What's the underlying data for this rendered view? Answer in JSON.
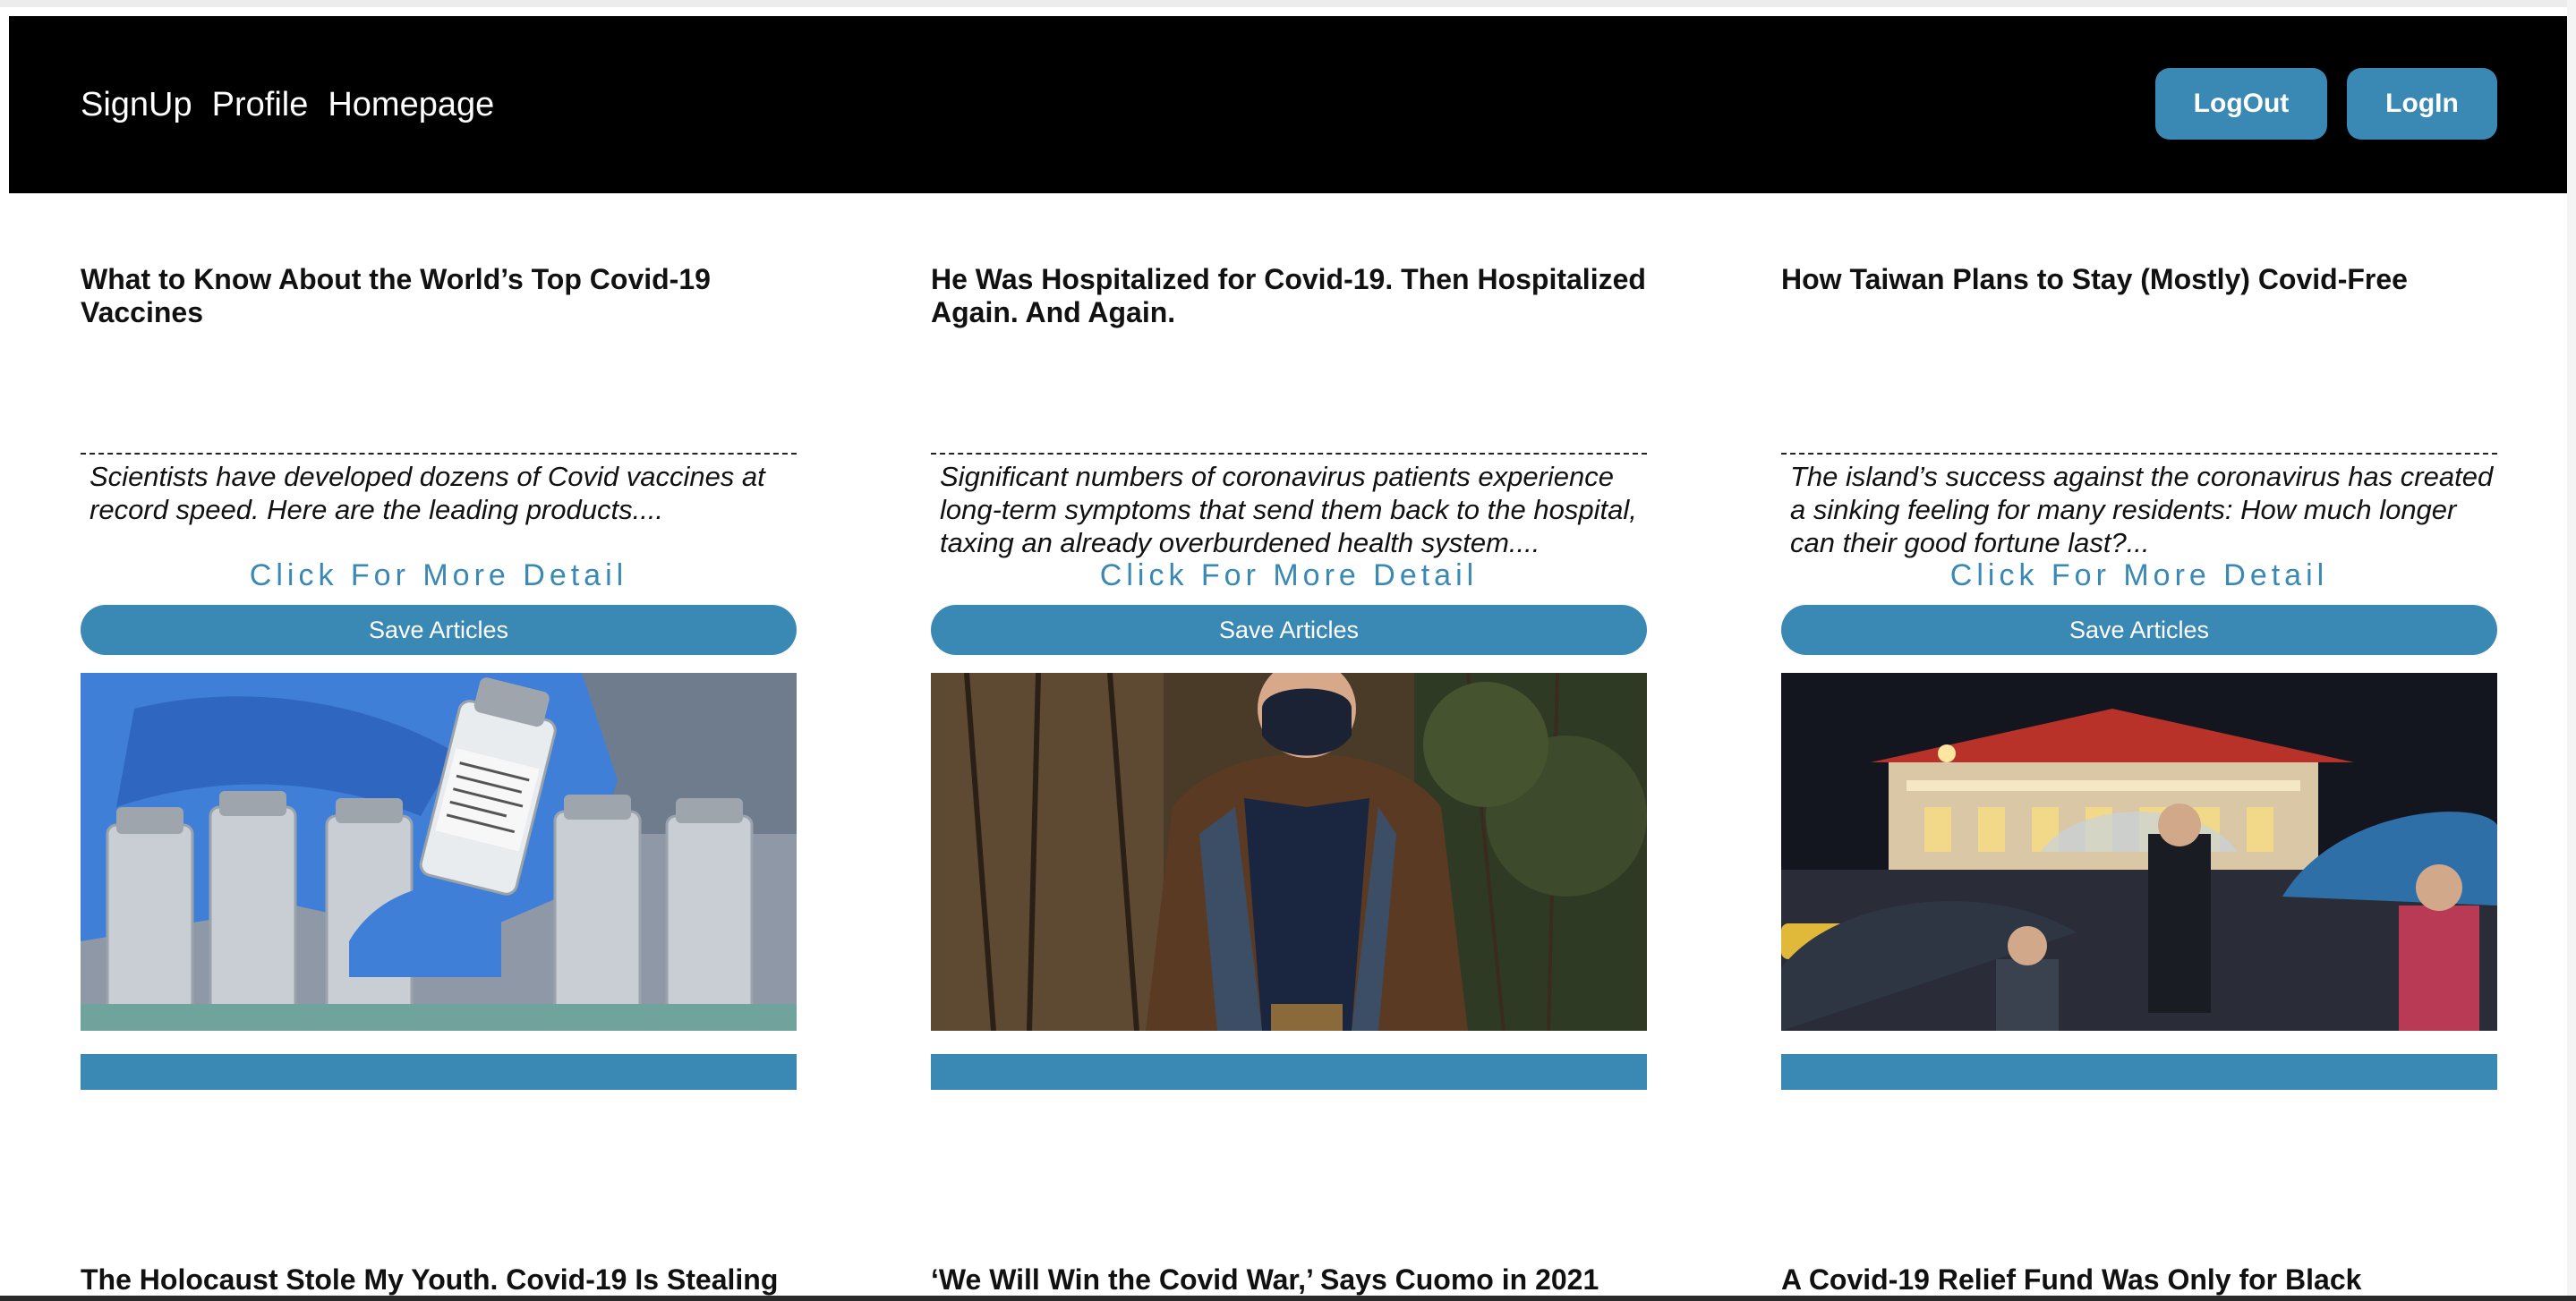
{
  "nav": {
    "links": [
      "SignUp",
      "Profile",
      "Homepage"
    ],
    "logout_label": "LogOut",
    "login_label": "LogIn"
  },
  "colors": {
    "accent": "#3a88b4",
    "navbar": "#000000"
  },
  "articles": [
    {
      "title": "What to Know About the World’s Top Covid-19 Vaccines",
      "description": "Scientists have developed dozens of Covid vaccines at record speed. Here are the leading products....",
      "detail_label": "Click For More Detail",
      "save_label": "Save Articles"
    },
    {
      "title": "He Was Hospitalized for Covid-19. Then Hospitalized Again. And Again.",
      "description": "Significant numbers of coronavirus patients experience long-term symptoms that send them back to the hospital, taxing an already overburdened health system....",
      "detail_label": "Click For More Detail",
      "save_label": "Save Articles"
    },
    {
      "title": "How Taiwan Plans to Stay (Mostly) Covid-Free",
      "description": "The island’s success against the coronavirus has created a sinking feeling for many residents: How much longer can their good fortune last?...",
      "detail_label": "Click For More Detail",
      "save_label": "Save Articles"
    }
  ],
  "next_titles": [
    "The Holocaust Stole My Youth. Covid-19 Is Stealing",
    "‘We Will Win the Covid War,’ Says Cuomo in 2021",
    "A Covid-19 Relief Fund Was Only for Black"
  ]
}
